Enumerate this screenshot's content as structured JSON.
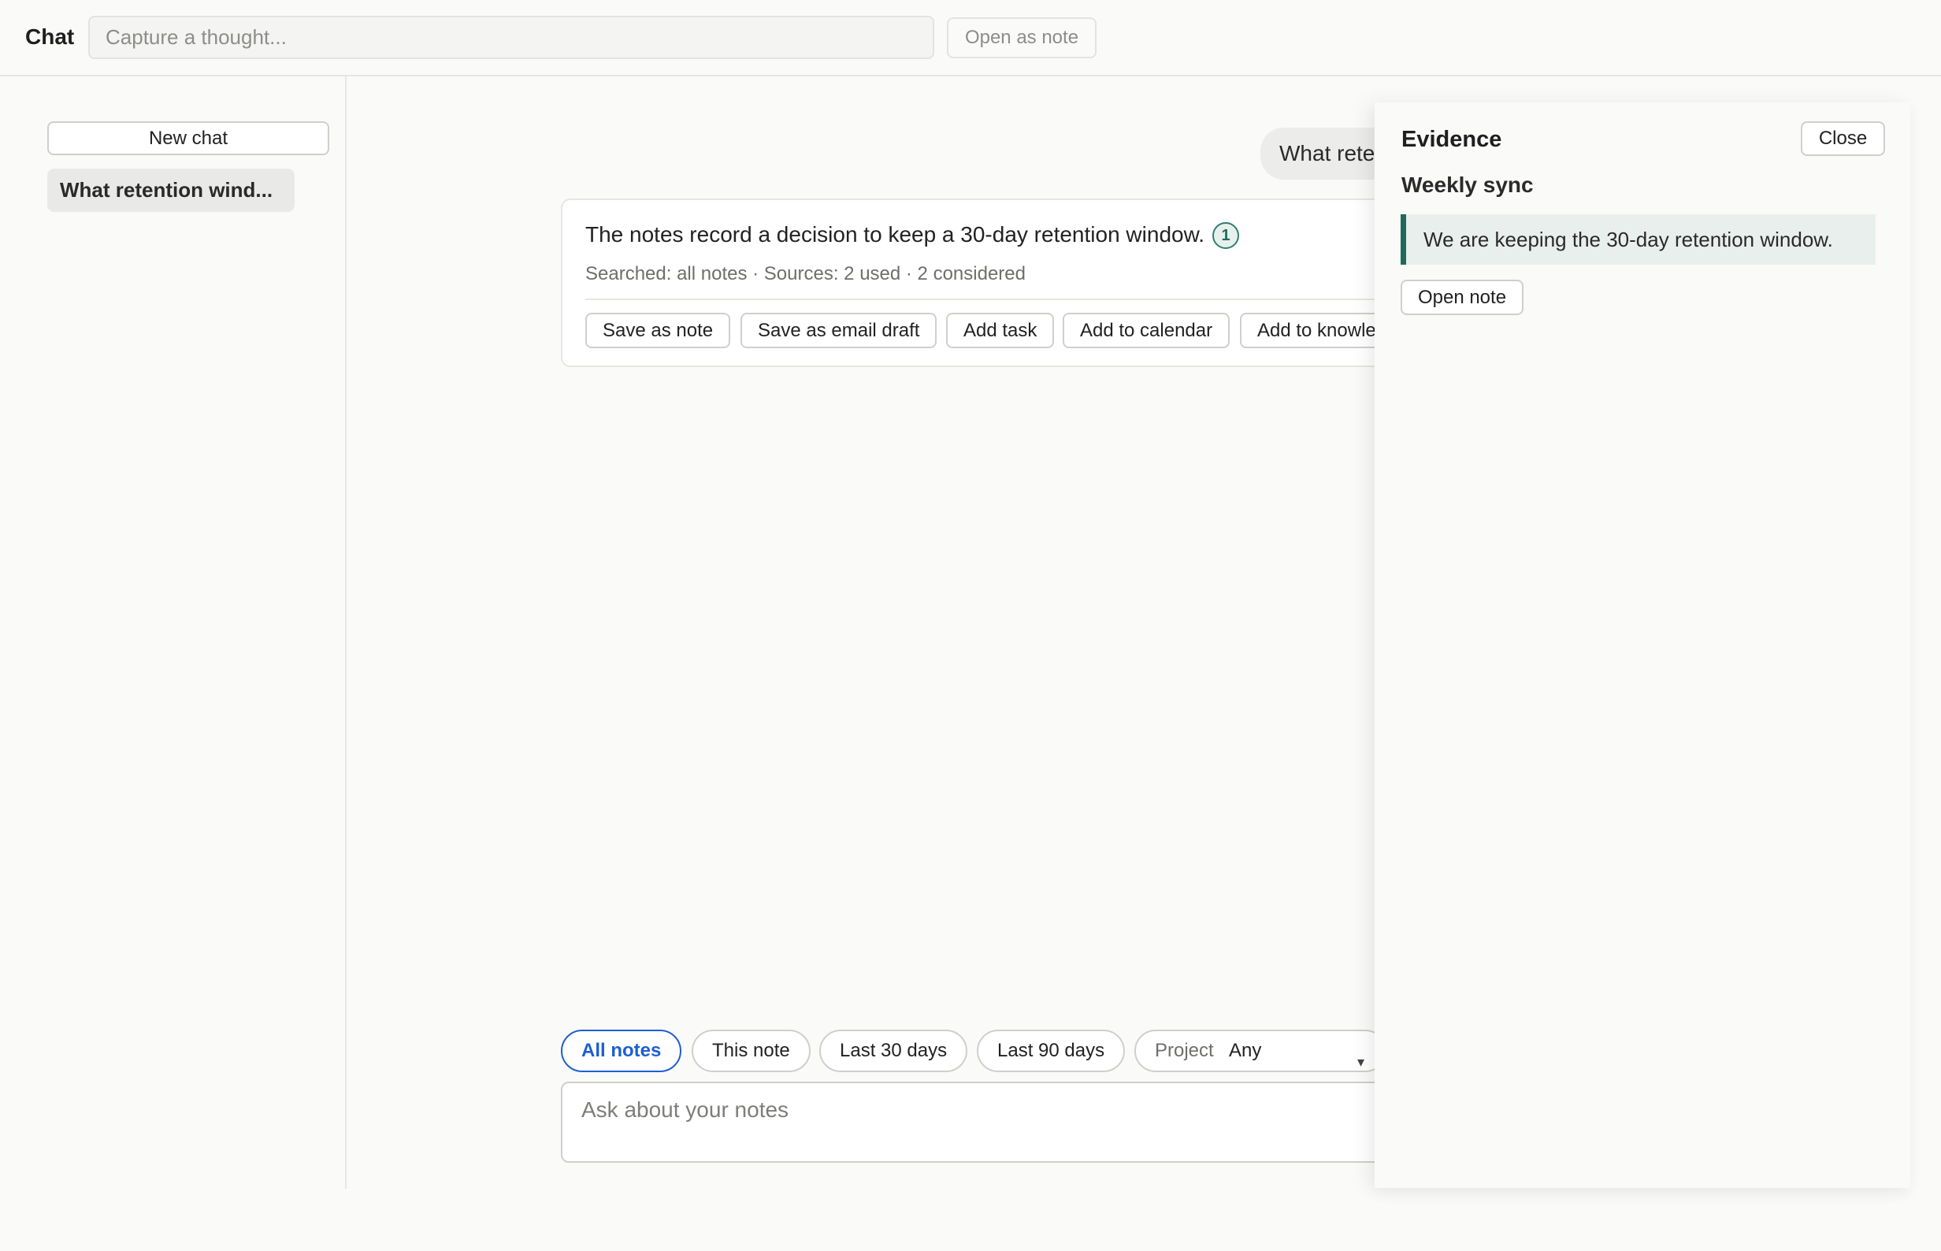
{
  "header": {
    "title": "Chat",
    "capture_placeholder": "Capture a thought...",
    "open_as_note_label": "Open as note"
  },
  "sidebar": {
    "new_chat_label": "New chat",
    "history": [
      {
        "label": "What retention wind..."
      }
    ]
  },
  "conversation": {
    "user_message": "What retention window did we decide on?",
    "answer": {
      "text": "The notes record a decision to keep a 30-day retention window.",
      "citation": "1",
      "meta": "Searched: all notes · Sources: 2 used · 2 considered",
      "actions": [
        {
          "label": "Save as note"
        },
        {
          "label": "Save as email draft"
        },
        {
          "label": "Add task"
        },
        {
          "label": "Add to calendar"
        },
        {
          "label": "Add to knowledge"
        }
      ]
    }
  },
  "scope": {
    "chips": [
      {
        "label": "All notes",
        "active": true
      },
      {
        "label": "This note",
        "active": false
      },
      {
        "label": "Last 30 days",
        "active": false
      },
      {
        "label": "Last 90 days",
        "active": false
      }
    ],
    "project_label": "Project",
    "project_value": "Any"
  },
  "composer": {
    "placeholder": "Ask about your notes"
  },
  "evidence": {
    "title": "Evidence",
    "close_label": "Close",
    "source_title": "Weekly sync",
    "quote": "We are keeping the 30-day retention window.",
    "open_note_label": "Open note"
  },
  "colors": {
    "accent": "#1d5fd1",
    "evidence_accent": "#1f6a5b",
    "background": "#fafaf9"
  }
}
